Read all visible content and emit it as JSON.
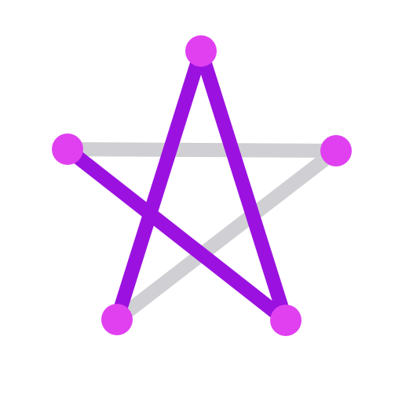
{
  "puzzle": {
    "type": "one-stroke line puzzle",
    "colors": {
      "background": "#ffffff",
      "drawn_line": "#9b12e0",
      "undrawn_line": "#d0d0d4",
      "node": "#e040f0"
    },
    "nodes": [
      {
        "id": "top"
      },
      {
        "id": "left"
      },
      {
        "id": "right"
      },
      {
        "id": "bottom-left"
      },
      {
        "id": "bottom-right"
      }
    ],
    "edges": [
      {
        "from": "top",
        "to": "bottom-left",
        "state": "drawn"
      },
      {
        "from": "top",
        "to": "bottom-right",
        "state": "drawn"
      },
      {
        "from": "left",
        "to": "bottom-right",
        "state": "drawn"
      },
      {
        "from": "left",
        "to": "right",
        "state": "undrawn"
      },
      {
        "from": "right",
        "to": "bottom-left",
        "state": "undrawn"
      }
    ]
  }
}
